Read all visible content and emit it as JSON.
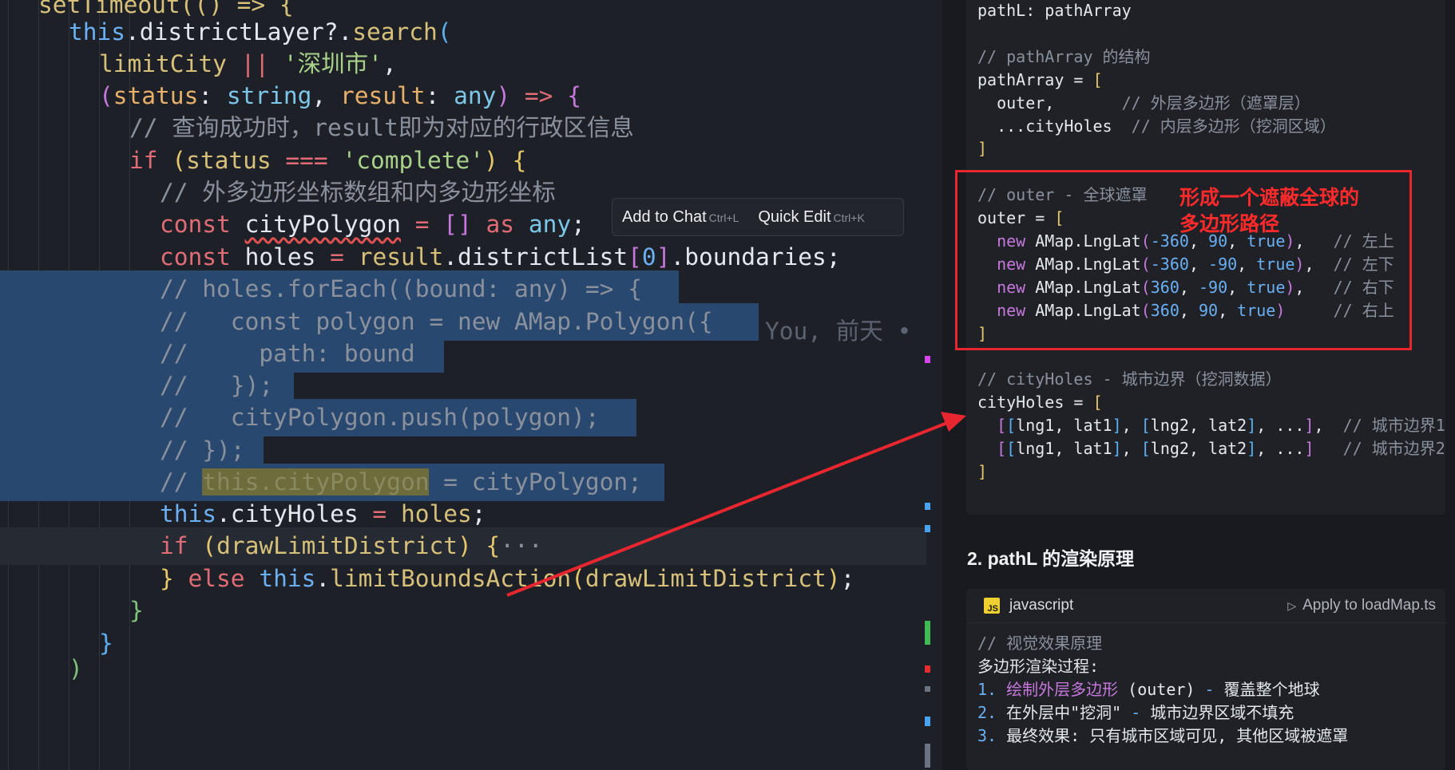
{
  "editor": {
    "lines": [
      {
        "segments": [
          [
            "setTimeout(() => {",
            "fn"
          ]
        ]
      },
      {
        "segments": [
          [
            "this",
            "this"
          ],
          [
            ".districtLayer?.",
            "var"
          ],
          [
            "search",
            "fn"
          ],
          [
            "(",
            "br3"
          ]
        ]
      },
      {
        "segments": [
          [
            "limitCity",
            "fn"
          ],
          [
            " || ",
            "kw"
          ],
          [
            "'深圳市'",
            "str"
          ],
          [
            ",",
            "pun"
          ]
        ]
      },
      {
        "segments": [
          [
            "(",
            "br2"
          ],
          [
            "status",
            "param"
          ],
          [
            ": ",
            "pun"
          ],
          [
            "string",
            "type"
          ],
          [
            ", ",
            "pun"
          ],
          [
            "result",
            "param"
          ],
          [
            ": ",
            "pun"
          ],
          [
            "any",
            "type"
          ],
          [
            ")",
            "br2"
          ],
          [
            " => ",
            "kw"
          ],
          [
            "{",
            "br2"
          ]
        ]
      },
      {
        "segments": [
          [
            "// 查询成功时，result即为对应的行政区信息",
            "cmt"
          ]
        ]
      },
      {
        "segments": [
          [
            "if",
            "kw"
          ],
          [
            " ",
            "pun"
          ],
          [
            "(",
            "br1"
          ],
          [
            "status",
            "fn"
          ],
          [
            " === ",
            "kw"
          ],
          [
            "'complete'",
            "str"
          ],
          [
            ")",
            "br1"
          ],
          [
            " ",
            "pun"
          ],
          [
            "{",
            "br1"
          ]
        ]
      },
      {
        "segments": [
          [
            "// 外多边形坐标数组和内多边形坐标",
            "cmt"
          ]
        ]
      },
      {
        "segments": [
          [
            "const",
            "kw"
          ],
          [
            " ",
            "pun"
          ],
          [
            "cityPolygon",
            "squig"
          ],
          [
            " = ",
            "kw"
          ],
          [
            "[]",
            "br2"
          ],
          [
            " as ",
            "kw"
          ],
          [
            "any",
            "type"
          ],
          [
            ";",
            "pun"
          ]
        ]
      },
      {
        "segments": [
          [
            "const",
            "kw"
          ],
          [
            " ",
            "pun"
          ],
          [
            "holes",
            "var"
          ],
          [
            " = ",
            "kw"
          ],
          [
            "result",
            "fn"
          ],
          [
            ".districtList",
            "var"
          ],
          [
            "[",
            "br2"
          ],
          [
            "0",
            "num"
          ],
          [
            "]",
            "br2"
          ],
          [
            ".boundaries;",
            "var"
          ]
        ]
      },
      {
        "segments": [
          [
            "// holes.forEach((bound: any) => {",
            "cmt"
          ]
        ]
      },
      {
        "segments": [
          [
            "//   const polygon = new AMap.Polygon({",
            "cmt"
          ]
        ]
      },
      {
        "segments": [
          [
            "//     path: bound",
            "cmt"
          ]
        ]
      },
      {
        "segments": [
          [
            "//   });",
            "cmt"
          ]
        ]
      },
      {
        "segments": [
          [
            "//   cityPolygon.push(polygon);",
            "cmt"
          ]
        ]
      },
      {
        "segments": [
          [
            "// });",
            "cmt"
          ]
        ]
      },
      {
        "segments": [
          [
            "// ",
            "cmt"
          ],
          [
            "this.cityPolygon",
            "hlw"
          ],
          [
            " = cityPolygon;",
            "cmt"
          ]
        ]
      },
      {
        "segments": [
          [
            "this",
            "this"
          ],
          [
            ".cityHoles",
            "var"
          ],
          [
            " = ",
            "kw"
          ],
          [
            "holes",
            "fn"
          ],
          [
            ";",
            "pun"
          ]
        ]
      },
      {
        "segments": [
          [
            "if",
            "kw"
          ],
          [
            " ",
            "pun"
          ],
          [
            "(",
            "br1"
          ],
          [
            "drawLimitDistrict",
            "fn"
          ],
          [
            ")",
            "br1"
          ],
          [
            " ",
            "pun"
          ],
          [
            "{",
            "br1"
          ],
          [
            "···",
            "cmt"
          ]
        ]
      },
      {
        "segments": [
          [
            "}",
            "br1"
          ],
          [
            " else ",
            "kw"
          ],
          [
            "this",
            "this"
          ],
          [
            ".",
            "pun"
          ],
          [
            "limitBoundsAction",
            "fn"
          ],
          [
            "(",
            "br1"
          ],
          [
            "drawLimitDistrict",
            "fn"
          ],
          [
            ")",
            "br1"
          ],
          [
            ";",
            "pun"
          ]
        ]
      },
      {
        "segments": [
          [
            "}",
            "br4"
          ]
        ]
      },
      {
        "segments": [
          [
            "}",
            "br3"
          ]
        ]
      },
      {
        "segments": [
          [
            ")",
            "br4"
          ]
        ]
      }
    ],
    "blame": "You, 前天 •",
    "inline_toolbar": {
      "add_to_chat": "Add to Chat",
      "add_to_chat_kb": "Ctrl+L",
      "quick_edit": "Quick Edit",
      "quick_edit_kb": "Ctrl+K"
    }
  },
  "chat": {
    "block1_lines": [
      [
        [
          "pathL: pathArray",
          "p-fn"
        ]
      ],
      [],
      [
        [
          "// pathArray 的结构",
          "p-cmt"
        ]
      ],
      [
        [
          "pathArray = ",
          "p-fn"
        ],
        [
          "[",
          "p-br"
        ]
      ],
      [
        [
          "  outer,       ",
          "p-fn"
        ],
        [
          "// 外层多边形（遮罩层）",
          "p-cmt"
        ]
      ],
      [
        [
          "  ...cityHoles  ",
          "p-fn"
        ],
        [
          "// 内层多边形（挖洞区域）",
          "p-cmt"
        ]
      ],
      [
        [
          "]",
          "p-br"
        ]
      ],
      [],
      [
        [
          "// outer - 全球遮罩",
          "p-cmt"
        ]
      ],
      [
        [
          "outer = ",
          "p-fn"
        ],
        [
          "[",
          "p-br"
        ]
      ],
      [
        [
          "  ",
          "p-fn"
        ],
        [
          "new",
          "p-kw"
        ],
        [
          " AMap.LngLat",
          "p-fn"
        ],
        [
          "(",
          "p-br2"
        ],
        [
          "-360",
          "p-num"
        ],
        [
          ", ",
          "p-fn"
        ],
        [
          "90",
          "p-num"
        ],
        [
          ", ",
          "p-fn"
        ],
        [
          "true",
          "p-tr"
        ],
        [
          ")",
          "p-br2"
        ],
        [
          ",   ",
          "p-fn"
        ],
        [
          "// 左上",
          "p-cmt"
        ]
      ],
      [
        [
          "  ",
          "p-fn"
        ],
        [
          "new",
          "p-kw"
        ],
        [
          " AMap.LngLat",
          "p-fn"
        ],
        [
          "(",
          "p-br2"
        ],
        [
          "-360",
          "p-num"
        ],
        [
          ", ",
          "p-fn"
        ],
        [
          "-90",
          "p-num"
        ],
        [
          ", ",
          "p-fn"
        ],
        [
          "true",
          "p-tr"
        ],
        [
          ")",
          "p-br2"
        ],
        [
          ",  ",
          "p-fn"
        ],
        [
          "// 左下",
          "p-cmt"
        ]
      ],
      [
        [
          "  ",
          "p-fn"
        ],
        [
          "new",
          "p-kw"
        ],
        [
          " AMap.LngLat",
          "p-fn"
        ],
        [
          "(",
          "p-br2"
        ],
        [
          "360",
          "p-num"
        ],
        [
          ", ",
          "p-fn"
        ],
        [
          "-90",
          "p-num"
        ],
        [
          ", ",
          "p-fn"
        ],
        [
          "true",
          "p-tr"
        ],
        [
          ")",
          "p-br2"
        ],
        [
          ",   ",
          "p-fn"
        ],
        [
          "// 右下",
          "p-cmt"
        ]
      ],
      [
        [
          "  ",
          "p-fn"
        ],
        [
          "new",
          "p-kw"
        ],
        [
          " AMap.LngLat",
          "p-fn"
        ],
        [
          "(",
          "p-br2"
        ],
        [
          "360",
          "p-num"
        ],
        [
          ", ",
          "p-fn"
        ],
        [
          "90",
          "p-num"
        ],
        [
          ", ",
          "p-fn"
        ],
        [
          "true",
          "p-tr"
        ],
        [
          ")",
          "p-br2"
        ],
        [
          "     ",
          "p-fn"
        ],
        [
          "// 右上",
          "p-cmt"
        ]
      ],
      [
        [
          "]",
          "p-br"
        ]
      ],
      [],
      [
        [
          "// cityHoles - 城市边界（挖洞数据）",
          "p-cmt"
        ]
      ],
      [
        [
          "cityHoles = ",
          "p-fn"
        ],
        [
          "[",
          "p-br"
        ]
      ],
      [
        [
          "  ",
          "p-fn"
        ],
        [
          "[",
          "p-br2"
        ],
        [
          "[",
          "p-br3"
        ],
        [
          "lng1, lat1",
          "p-fn"
        ],
        [
          "]",
          "p-br3"
        ],
        [
          ", ",
          "p-fn"
        ],
        [
          "[",
          "p-br3"
        ],
        [
          "lng2, lat2",
          "p-fn"
        ],
        [
          "]",
          "p-br3"
        ],
        [
          ", ...",
          "p-fn"
        ],
        [
          "]",
          "p-br2"
        ],
        [
          ",  ",
          "p-fn"
        ],
        [
          "// 城市边界1",
          "p-cmt"
        ]
      ],
      [
        [
          "  ",
          "p-fn"
        ],
        [
          "[",
          "p-br2"
        ],
        [
          "[",
          "p-br3"
        ],
        [
          "lng1, lat1",
          "p-fn"
        ],
        [
          "]",
          "p-br3"
        ],
        [
          ", ",
          "p-fn"
        ],
        [
          "[",
          "p-br3"
        ],
        [
          "lng2, lat2",
          "p-fn"
        ],
        [
          "]",
          "p-br3"
        ],
        [
          ", ...",
          "p-fn"
        ],
        [
          "]",
          "p-br2"
        ],
        [
          "   ",
          "p-fn"
        ],
        [
          "// 城市边界2",
          "p-cmt"
        ]
      ],
      [
        [
          "]",
          "p-br"
        ]
      ]
    ],
    "annotation_line1": "形成一个遮蔽全球的",
    "annotation_line2": "多边形路径",
    "section_heading": "2. pathL 的渲染原理",
    "block2": {
      "badge": "JS",
      "lang": "javascript",
      "apply": "Apply to loadMap.ts",
      "lines": [
        [
          [
            "// 视觉效果原理",
            "p-cmt"
          ]
        ],
        [
          [
            "多边形渲染过程:",
            "p-fn"
          ]
        ],
        [
          [
            "1. ",
            "p-tr"
          ],
          [
            "绘制外层多边形 ",
            "p-br2"
          ],
          [
            "(outer)",
            "p-fn"
          ],
          [
            " - ",
            "p-tr"
          ],
          [
            "覆盖整个地球",
            "p-fn"
          ]
        ],
        [
          [
            "2. ",
            "p-tr"
          ],
          [
            "在外层中\"挖洞\"",
            "p-fn"
          ],
          [
            " - ",
            "p-tr"
          ],
          [
            "城市边界区域不填充",
            "p-fn"
          ]
        ],
        [
          [
            "3. ",
            "p-tr"
          ],
          [
            "最终效果: 只有城市区域可见, 其他区域被遮罩",
            "p-fn"
          ]
        ]
      ]
    }
  },
  "colors": {
    "selection": "#284870",
    "annotation_red": "#e8262f",
    "editor_bg": "#1e2027",
    "panel_bg": "#181a1f"
  }
}
